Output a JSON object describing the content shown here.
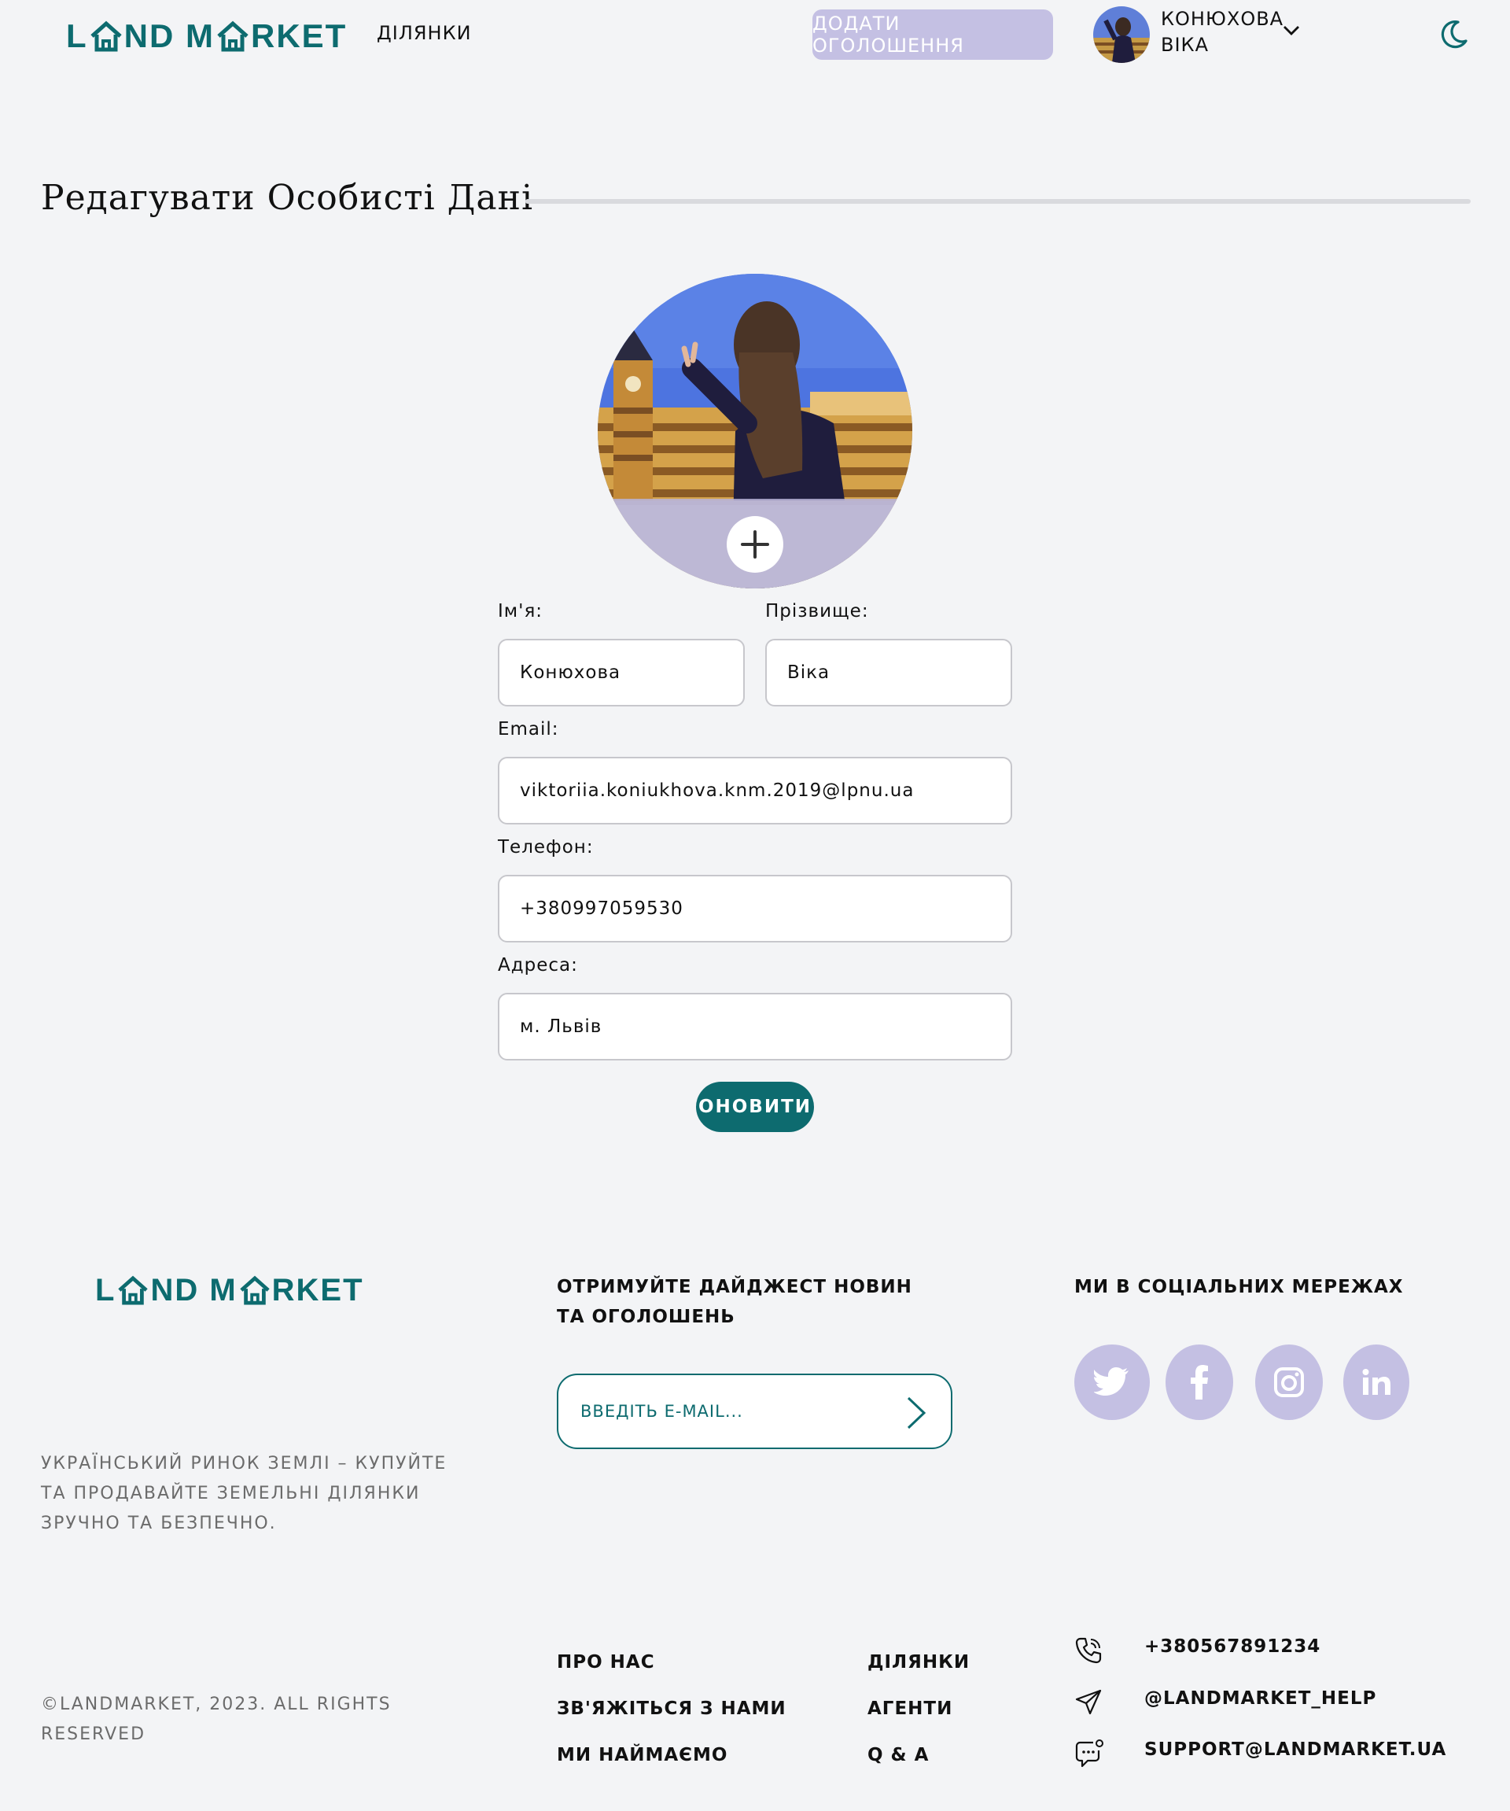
{
  "header": {
    "logo_text_left": "L",
    "logo_text_mid": "ND M",
    "logo_text_right": "RKET",
    "nav_plots": "ДІЛЯНКИ",
    "add_listing": "ДОДАТИ ОГОЛОШЕННЯ",
    "user_first_line": "КОНЮХОВА",
    "user_second_line": "ВІКА"
  },
  "page": {
    "title": "Редагувати Особисті Дані"
  },
  "form": {
    "first_name_label": "Ім'я:",
    "first_name_value": "Конюхова",
    "last_name_label": "Прізвище:",
    "last_name_value": "Віка",
    "email_label": "Email:",
    "email_value": "viktoriia.koniukhova.knm.2019@lpnu.ua",
    "phone_label": "Телефон:",
    "phone_value": "+380997059530",
    "address_label": "Адреса:",
    "address_value": "м. Львів",
    "submit_label": "ОНОВИТИ"
  },
  "footer": {
    "tagline": "УКРАЇНСЬКИЙ РИНОК ЗЕМЛІ – КУПУЙТЕ ТА ПРОДАВАЙТЕ ЗЕМЕЛЬНІ ДІЛЯНКИ ЗРУЧНО ТА БЕЗПЕЧНО.",
    "newsletter_heading": "ОТРИМУЙТЕ ДАЙДЖЕСТ НОВИН ТА ОГОЛОШЕНЬ",
    "email_placeholder": "ВВЕДІТЬ E-MAIL...",
    "social_heading": "МИ В СОЦІАЛЬНИХ МЕРЕЖАХ",
    "social_icons": [
      "twitter-icon",
      "facebook-icon",
      "instagram-icon",
      "linkedin-icon"
    ],
    "links_col1": [
      "ПРО НАС",
      "ЗВ'ЯЖІТЬСЯ З НАМИ",
      "МИ НАЙМАЄМО"
    ],
    "links_col2": [
      "ДІЛЯНКИ",
      "АГЕНТИ",
      "Q & A"
    ],
    "phone": "+380567891234",
    "telegram": "@LANDMARKET_HELP",
    "support_email": "SUPPORT@LANDMARKET.UA",
    "copyright": "©LANDMARKET, 2023. ALL RIGHTS RESERVED"
  },
  "colors": {
    "brand": "#0d6b6f",
    "accent_lavender": "#c4c0e3",
    "background": "#f3f4f6"
  }
}
